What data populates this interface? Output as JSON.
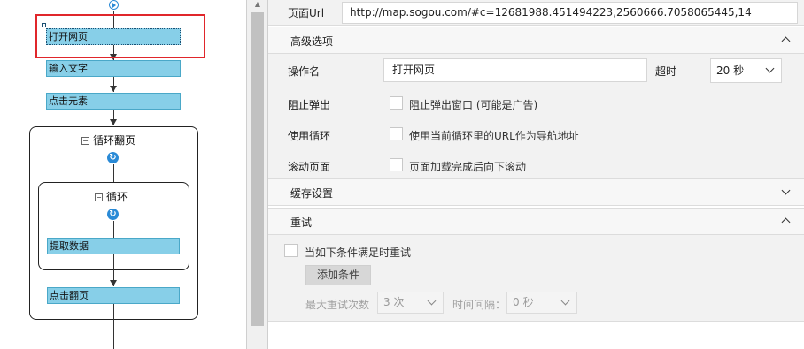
{
  "flow": {
    "steps": {
      "open_page": "打开网页",
      "input_text": "输入文字",
      "click_element": "点击元素",
      "extract_data": "提取数据",
      "click_next_page": "点击翻页"
    },
    "loops": {
      "outer_title": "循环翻页",
      "inner_title": "循环"
    },
    "minus_glyph": "−",
    "loop_glyph": "↻"
  },
  "page_url": {
    "label": "页面Url",
    "value": "http://map.sogou.com/#c=12681988.451494223,2560666.7058065445,14"
  },
  "advanced": {
    "title": "高级选项",
    "expanded": true,
    "operation_name_label": "操作名",
    "operation_name_value": "打开网页",
    "timeout_label": "超时",
    "timeout_value": "20 秒",
    "block_popup_label": "阻止弹出",
    "block_popup_checkbox": "阻止弹出窗口 (可能是广告)",
    "block_popup_checked": false,
    "use_loop_label": "使用循环",
    "use_loop_checkbox": "使用当前循环里的URL作为导航地址",
    "use_loop_checked": false,
    "scroll_label": "滚动页面",
    "scroll_checkbox": "页面加载完成后向下滚动",
    "scroll_checked": false
  },
  "cache": {
    "title": "缓存设置",
    "expanded": false
  },
  "retry": {
    "title": "重试",
    "expanded": true,
    "retry_checkbox": "当如下条件满足时重试",
    "retry_checked": false,
    "add_condition": "添加条件",
    "max_retry_label": "最大重试次数",
    "max_retry_value": "3 次",
    "interval_label": "时间间隔：",
    "interval_value": "0 秒"
  },
  "colors": {
    "step_fill": "#87cfe8",
    "highlight": "#e0262b",
    "loop_icon": "#2a8ad6"
  }
}
